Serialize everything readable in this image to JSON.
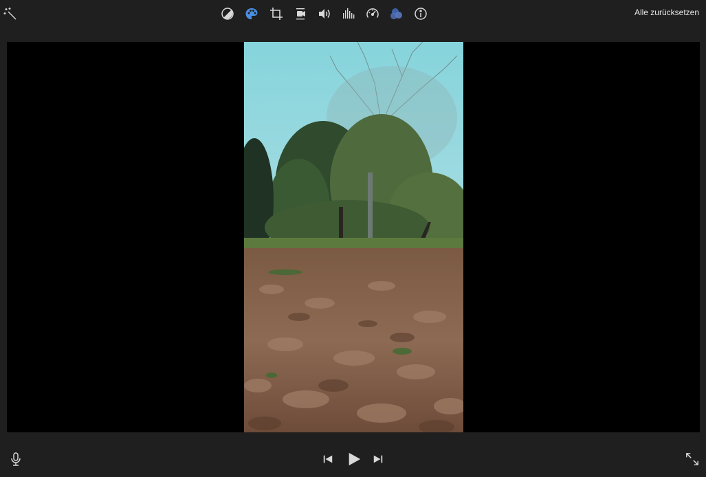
{
  "toolbar": {
    "tools": [
      {
        "name": "magic-wand-icon",
        "label": "Enhance"
      },
      {
        "name": "color-balance-icon",
        "label": "Color balance"
      },
      {
        "name": "color-correction-icon",
        "label": "Color correction"
      },
      {
        "name": "crop-icon",
        "label": "Cropping"
      },
      {
        "name": "stabilization-icon",
        "label": "Stabilization"
      },
      {
        "name": "volume-icon",
        "label": "Volume"
      },
      {
        "name": "noise-reduction-icon",
        "label": "Noise reduction and equalizer"
      },
      {
        "name": "speed-icon",
        "label": "Speed"
      },
      {
        "name": "clip-filter-icon",
        "label": "Clip filter and audio effects"
      },
      {
        "name": "info-icon",
        "label": "Clip information"
      }
    ],
    "active_tool": "color-correction-icon",
    "reset_label": "Alle zurücksetzen"
  },
  "controls": {
    "voiceover_icon": "microphone-icon",
    "prev_icon": "skip-back-icon",
    "play_icon": "play-icon",
    "next_icon": "skip-forward-icon",
    "fullscreen_icon": "fullscreen-icon"
  },
  "colors": {
    "background": "#1f1f20",
    "icon": "#d9d9d9",
    "accent": "#4a90e2",
    "viewer": "#000000"
  }
}
